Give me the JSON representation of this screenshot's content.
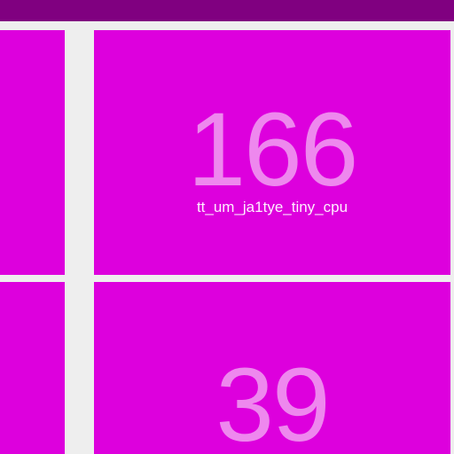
{
  "tiles": [
    {
      "value": "166",
      "label": "tt_um_ja1tye_tiny_cpu"
    },
    {
      "value": "39",
      "label": ""
    }
  ],
  "colors": {
    "top_bar": "#800080",
    "tile_background": "#dd00dd",
    "value_text": "#ee88ee",
    "label_text": "#ffeeff",
    "page_background": "#eeeeee"
  }
}
